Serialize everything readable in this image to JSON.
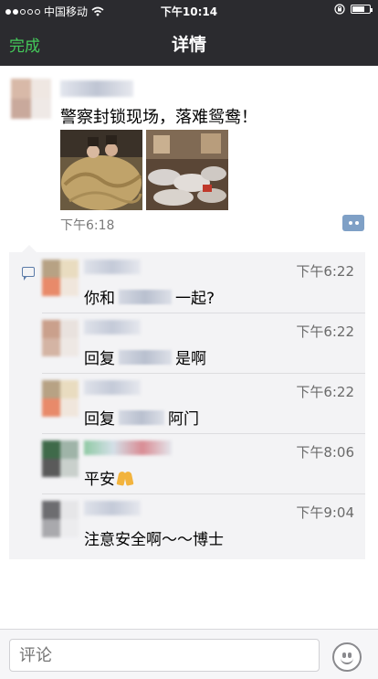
{
  "status_bar": {
    "carrier": "中国移动",
    "time": "下午10:14",
    "signal_dots": [
      true,
      true,
      false,
      false,
      false
    ],
    "battery_level": 0.7
  },
  "nav": {
    "done_label": "完成",
    "title": "详情",
    "accent_color": "#44c95a"
  },
  "post": {
    "text": "警察封锁现场，落难鸳鸯！",
    "time": "下午6:18",
    "photos": [
      "photo-1",
      "photo-2"
    ],
    "more_icon": "more-dots-icon"
  },
  "comments": [
    {
      "time": "下午6:22",
      "pre": "你和",
      "post": "一起?"
    },
    {
      "time": "下午6:22",
      "pre": "回复",
      "post": "是啊"
    },
    {
      "time": "下午6:22",
      "pre": "回复",
      "post": "阿门"
    },
    {
      "time": "下午8:06",
      "pre": "平安",
      "post": ""
    },
    {
      "time": "下午9:04",
      "pre": "注意安全啊～～博士",
      "post": ""
    }
  ],
  "input": {
    "placeholder": "评论",
    "emoji_icon": "emoji-icon"
  }
}
